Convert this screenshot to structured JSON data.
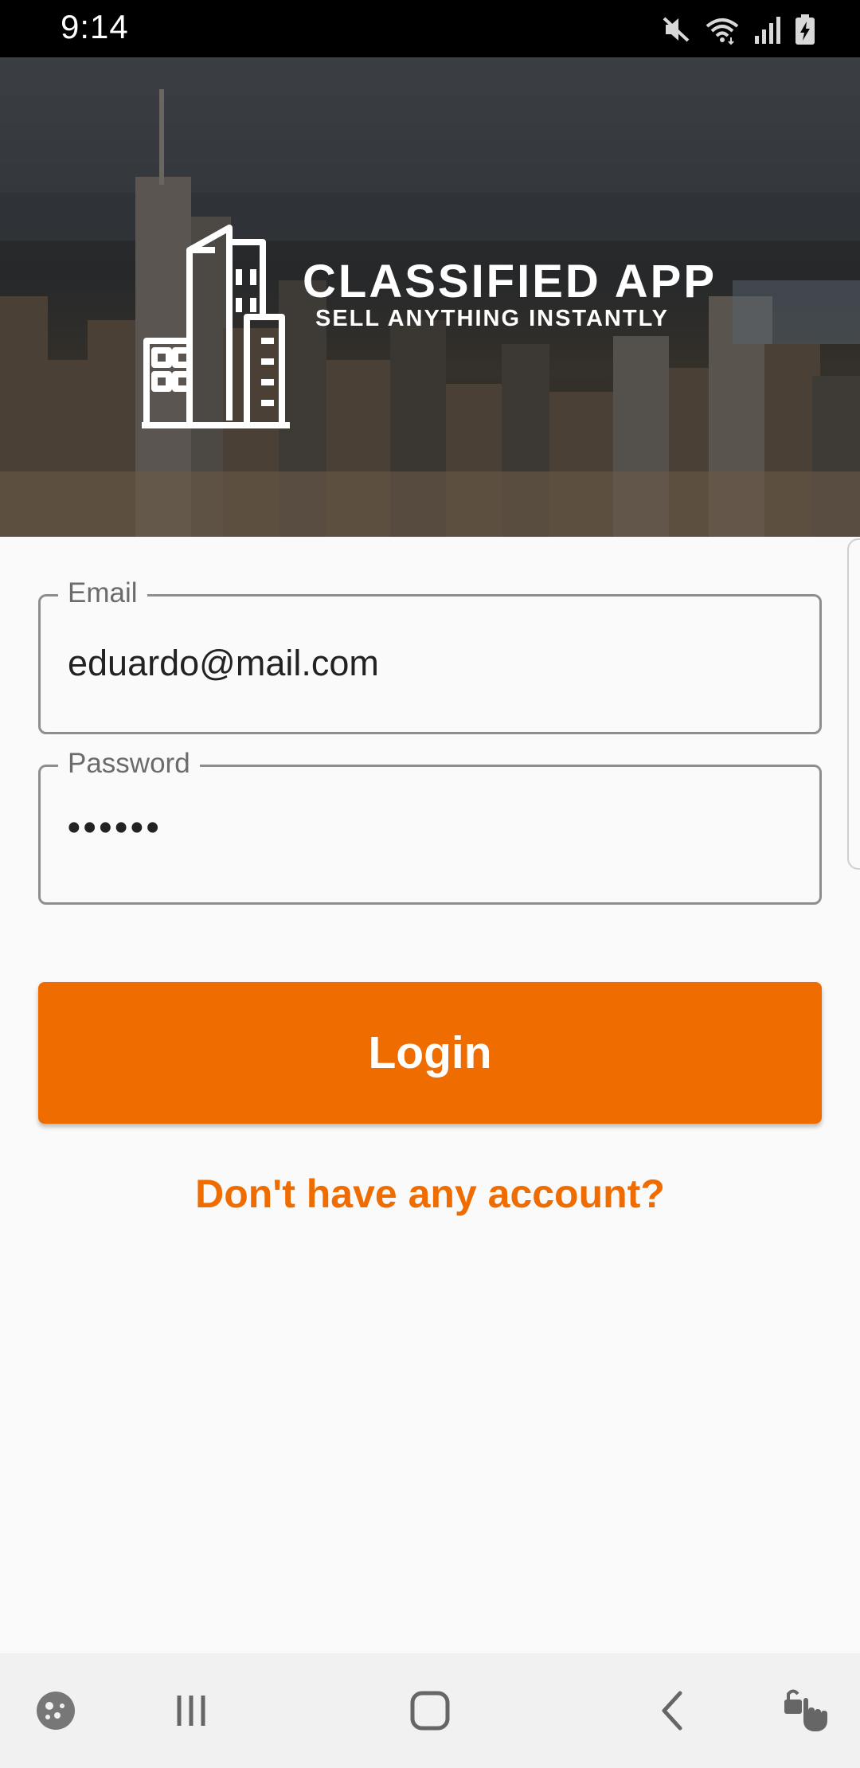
{
  "status_bar": {
    "time": "9:14",
    "icons": [
      "mute-icon",
      "wifi-icon",
      "signal-icon",
      "battery-charging-icon"
    ]
  },
  "hero": {
    "logo_icon": "city-buildings-icon",
    "title": "CLASSIFIED APP",
    "subtitle": "SELL ANYTHING INSTANTLY"
  },
  "form": {
    "email": {
      "label": "Email",
      "value": "eduardo@mail.com"
    },
    "password": {
      "label": "Password",
      "value": "••••••"
    },
    "login_label": "Login",
    "signup_link": "Don't have any account?"
  },
  "colors": {
    "accent": "#ef6c00",
    "background": "#fafafa",
    "status_bar": "#000000",
    "nav_bar": "#f1f1f1"
  },
  "nav_bar": {
    "icons": [
      "game-tools-icon",
      "recent-apps-icon",
      "home-icon",
      "back-icon",
      "screen-pin-icon"
    ]
  }
}
